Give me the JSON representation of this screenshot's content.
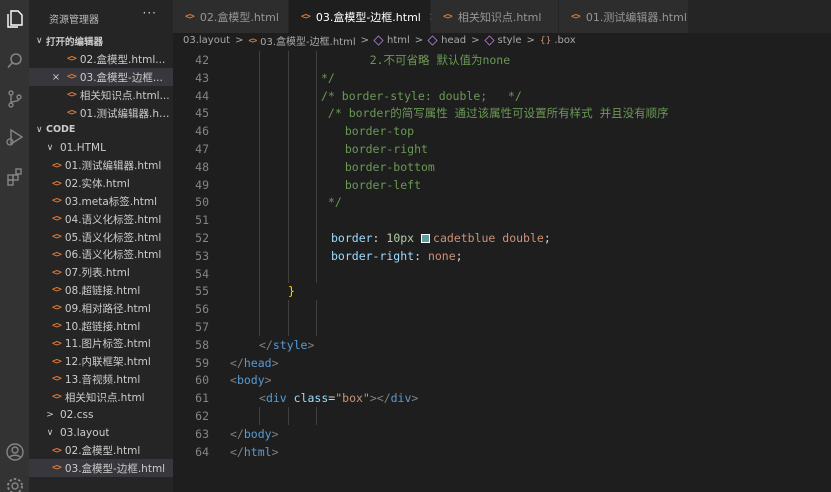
{
  "explorer": {
    "title": "资源管理器",
    "more": "···",
    "open_editors": {
      "header": "打开的编辑器",
      "items": [
        {
          "label": "02.盒模型.html...",
          "selected": false,
          "close": false
        },
        {
          "label": "03.盒模型-边框...",
          "selected": true,
          "close": true
        },
        {
          "label": "相关知识点.html...",
          "selected": false,
          "close": false
        },
        {
          "label": "01.测试编辑器.ht...",
          "selected": false,
          "close": false
        }
      ]
    },
    "code_section": {
      "header": "CODE",
      "folder_html": "01.HTML",
      "html_files": [
        "01.测试编辑器.html",
        "02.实体.html",
        "03.meta标签.html",
        "04.语义化标签.html",
        "05.语义化标签.html",
        "06.语义化标签.html",
        "07.列表.html",
        "08.超链接.html",
        "09.相对路径.html",
        "10.超链接.html",
        "11.图片标签.html",
        "12.内联框架.html",
        "13.音视频.html",
        "相关知识点.html"
      ],
      "folder_css": "02.css",
      "folder_layout": "03.layout",
      "layout_files": [
        "02.盒模型.html",
        "03.盒模型-边框.html"
      ]
    }
  },
  "tabs": [
    {
      "label": "02.盒模型.html",
      "active": false
    },
    {
      "label": "03.盒模型-边框.html",
      "active": true
    },
    {
      "label": "相关知识点.html",
      "active": false
    },
    {
      "label": "01.测试编辑器.html",
      "active": false
    }
  ],
  "tab_close_glyph": "×",
  "breadcrumb": {
    "folder": "03.layout",
    "file": "03.盒模型-边框.html",
    "html": "html",
    "head": "head",
    "style": "style",
    "selector": ".box"
  },
  "icons": {
    "activity": [
      "files-icon",
      "search-icon",
      "source-control-icon",
      "run-debug-icon",
      "extensions-icon",
      "account-icon",
      "settings-gear-icon"
    ],
    "file_icon_glyph": "<>",
    "chevron_down": "∨",
    "chevron_right": ">",
    "close": "×"
  },
  "colors": {
    "accent_html": "#e37933",
    "comment": "#6a9955",
    "tag": "#569cd6",
    "property": "#9cdcfe",
    "string": "#ce9178",
    "number": "#b5cea8",
    "swatch_cadetblue": "#5f9ea0"
  },
  "code_lines": [
    {
      "n": "42",
      "tokens": [
        {
          "t": "    2.不可省略 默认值为none",
          "c": "com"
        }
      ],
      "indent": 112
    },
    {
      "n": "43",
      "tokens": [
        {
          "t": "*/",
          "c": "com"
        }
      ],
      "indent": 91
    },
    {
      "n": "44",
      "tokens": [
        {
          "t": "/* border-style: double;   */",
          "c": "com"
        }
      ],
      "indent": 91
    },
    {
      "n": "45",
      "tokens": [
        {
          "t": " /* border的简写属性 通过该属性可设置所有样式 并且没有顺序",
          "c": "com"
        }
      ],
      "indent": 91
    },
    {
      "n": "46",
      "tokens": [
        {
          "t": "  border-top",
          "c": "com"
        }
      ],
      "indent": 101
    },
    {
      "n": "47",
      "tokens": [
        {
          "t": "  border-right",
          "c": "com"
        }
      ],
      "indent": 101
    },
    {
      "n": "48",
      "tokens": [
        {
          "t": "  border-bottom",
          "c": "com"
        }
      ],
      "indent": 101
    },
    {
      "n": "49",
      "tokens": [
        {
          "t": "  border-left",
          "c": "com"
        }
      ],
      "indent": 101
    },
    {
      "n": "50",
      "tokens": [
        {
          "t": " */",
          "c": "com"
        }
      ],
      "indent": 91
    },
    {
      "n": "51",
      "tokens": [],
      "indent": 0
    },
    {
      "n": "52",
      "tokens": [
        {
          "t": "border",
          "c": "prop"
        },
        {
          "t": ": ",
          "c": "plain"
        },
        {
          "t": "10px",
          "c": "num"
        },
        {
          "t": " ",
          "c": "plain"
        },
        {
          "t": "",
          "c": "swatch"
        },
        {
          "t": "cadetblue double",
          "c": "val"
        },
        {
          "t": ";",
          "c": "plain"
        }
      ],
      "indent": 101
    },
    {
      "n": "53",
      "tokens": [
        {
          "t": "border-right",
          "c": "prop"
        },
        {
          "t": ": ",
          "c": "plain"
        },
        {
          "t": "none",
          "c": "val"
        },
        {
          "t": ";",
          "c": "plain"
        }
      ],
      "indent": 101
    },
    {
      "n": "54",
      "tokens": [],
      "indent": 0
    },
    {
      "n": "55",
      "tokens": [
        {
          "t": "}",
          "c": "brace"
        }
      ],
      "indent": 58
    },
    {
      "n": "56",
      "tokens": [],
      "indent": 0
    },
    {
      "n": "57",
      "tokens": [],
      "indent": 0
    },
    {
      "n": "58",
      "tokens": [
        {
          "t": "</",
          "c": "punc"
        },
        {
          "t": "style",
          "c": "tag"
        },
        {
          "t": ">",
          "c": "punc"
        }
      ],
      "indent": 29
    },
    {
      "n": "59",
      "tokens": [
        {
          "t": "</",
          "c": "punc"
        },
        {
          "t": "head",
          "c": "tag"
        },
        {
          "t": ">",
          "c": "punc"
        }
      ],
      "indent": 0
    },
    {
      "n": "60",
      "tokens": [
        {
          "t": "<",
          "c": "punc"
        },
        {
          "t": "body",
          "c": "tag"
        },
        {
          "t": ">",
          "c": "punc"
        }
      ],
      "indent": 0
    },
    {
      "n": "61",
      "tokens": [
        {
          "t": "<",
          "c": "punc"
        },
        {
          "t": "div",
          "c": "tag"
        },
        {
          "t": " ",
          "c": "plain"
        },
        {
          "t": "class",
          "c": "attr"
        },
        {
          "t": "=",
          "c": "plain"
        },
        {
          "t": "\"box\"",
          "c": "str"
        },
        {
          "t": "></",
          "c": "punc"
        },
        {
          "t": "div",
          "c": "tag"
        },
        {
          "t": ">",
          "c": "punc"
        }
      ],
      "indent": 29
    },
    {
      "n": "62",
      "tokens": [],
      "indent": 0
    },
    {
      "n": "63",
      "tokens": [
        {
          "t": "</",
          "c": "punc"
        },
        {
          "t": "body",
          "c": "tag"
        },
        {
          "t": ">",
          "c": "punc"
        }
      ],
      "indent": 0
    },
    {
      "n": "64",
      "tokens": [
        {
          "t": "</",
          "c": "punc"
        },
        {
          "t": "html",
          "c": "tag"
        },
        {
          "t": ">",
          "c": "punc"
        }
      ],
      "indent": 0
    }
  ]
}
